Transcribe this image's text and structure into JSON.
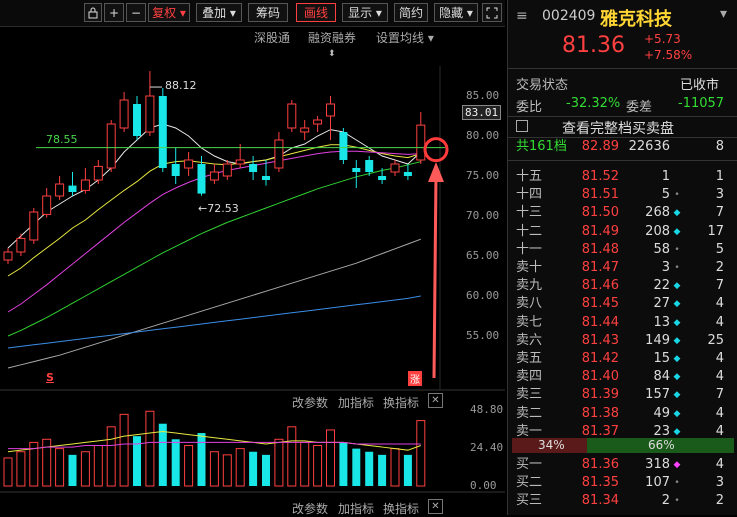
{
  "toolbar": {
    "buttons": [
      "+",
      "−",
      "复权",
      "叠加",
      "筹码",
      "画线",
      "显示",
      "简约",
      "隐藏"
    ],
    "icons": [
      "lock-icon",
      "expand-icon"
    ],
    "subnav": [
      "深股通",
      "融资融券",
      "设置均线"
    ]
  },
  "chart": {
    "price_ticks": [
      "85.00",
      "83.01",
      "80.00",
      "75.00",
      "70.00",
      "65.00",
      "60.00",
      "55.00"
    ],
    "high_label": "88.12",
    "low_label": "72.53",
    "ref_label": "78.55",
    "s_marker": "S",
    "zhang_badge": "涨",
    "indicator_bar1": [
      "改参数",
      "加指标",
      "换指标"
    ],
    "volume_ticks": [
      "48.80",
      "24.40",
      "0.00"
    ],
    "indicator_bar2": [
      "改参数",
      "加指标",
      "换指标"
    ],
    "candles": [
      {
        "o": 64.5,
        "c": 65.5,
        "h": 66.0,
        "l": 64.0
      },
      {
        "o": 65.5,
        "c": 67.2,
        "h": 67.8,
        "l": 65.0
      },
      {
        "o": 67.0,
        "c": 70.5,
        "h": 71.0,
        "l": 66.5
      },
      {
        "o": 70.2,
        "c": 72.5,
        "h": 73.5,
        "l": 69.8
      },
      {
        "o": 72.5,
        "c": 74.0,
        "h": 75.0,
        "l": 72.0
      },
      {
        "o": 73.8,
        "c": 73.0,
        "h": 75.5,
        "l": 72.5
      },
      {
        "o": 73.2,
        "c": 74.5,
        "h": 76.0,
        "l": 72.8
      },
      {
        "o": 74.5,
        "c": 76.2,
        "h": 77.0,
        "l": 74.0
      },
      {
        "o": 76.0,
        "c": 81.5,
        "h": 82.0,
        "l": 75.5
      },
      {
        "o": 81.0,
        "c": 84.5,
        "h": 85.5,
        "l": 80.5
      },
      {
        "o": 84.0,
        "c": 80.0,
        "h": 85.0,
        "l": 79.5
      },
      {
        "o": 80.5,
        "c": 85.0,
        "h": 88.12,
        "l": 80.0
      },
      {
        "o": 85.0,
        "c": 76.0,
        "h": 86.0,
        "l": 75.5
      },
      {
        "o": 76.5,
        "c": 75.0,
        "h": 78.5,
        "l": 74.0
      },
      {
        "o": 76.0,
        "c": 77.0,
        "h": 78.0,
        "l": 75.0
      },
      {
        "o": 76.5,
        "c": 72.8,
        "h": 77.5,
        "l": 72.53
      },
      {
        "o": 74.5,
        "c": 75.5,
        "h": 76.5,
        "l": 74.0
      },
      {
        "o": 75.0,
        "c": 76.5,
        "h": 77.0,
        "l": 74.5
      },
      {
        "o": 76.5,
        "c": 77.0,
        "h": 79.0,
        "l": 76.0
      },
      {
        "o": 76.5,
        "c": 75.5,
        "h": 77.5,
        "l": 74.5
      },
      {
        "o": 75.0,
        "c": 74.5,
        "h": 77.0,
        "l": 73.8
      },
      {
        "o": 76.0,
        "c": 79.5,
        "h": 80.5,
        "l": 75.5
      },
      {
        "o": 81.0,
        "c": 84.0,
        "h": 84.5,
        "l": 80.5
      },
      {
        "o": 80.5,
        "c": 81.0,
        "h": 82.0,
        "l": 79.5
      },
      {
        "o": 81.5,
        "c": 82.0,
        "h": 82.5,
        "l": 80.5
      },
      {
        "o": 82.5,
        "c": 84.0,
        "h": 85.0,
        "l": 79.5
      },
      {
        "o": 80.5,
        "c": 77.0,
        "h": 81.0,
        "l": 76.5
      },
      {
        "o": 76.0,
        "c": 75.5,
        "h": 77.0,
        "l": 73.5
      },
      {
        "o": 77.0,
        "c": 75.5,
        "h": 77.5,
        "l": 75.0
      },
      {
        "o": 75.0,
        "c": 74.5,
        "h": 76.0,
        "l": 74.0
      },
      {
        "o": 75.5,
        "c": 76.5,
        "h": 77.0,
        "l": 75.0
      },
      {
        "o": 75.5,
        "c": 75.0,
        "h": 76.5,
        "l": 74.5
      },
      {
        "o": 77.0,
        "c": 81.36,
        "h": 83.01,
        "l": 76.5
      }
    ],
    "ma": {
      "white": [
        66.0,
        67.5,
        69.0,
        70.5,
        71.5,
        72.5,
        73.3,
        74.5,
        76.0,
        78.0,
        79.5,
        81.0,
        81.5,
        81.0,
        80.0,
        78.5,
        77.5,
        76.8,
        76.5,
        76.8,
        77.0,
        77.5,
        78.5,
        79.0,
        80.0,
        80.8,
        80.5,
        79.5,
        78.5,
        77.5,
        77.0,
        76.5,
        78.0
      ],
      "yellow": [
        62.5,
        63.5,
        64.8,
        66.0,
        67.2,
        68.5,
        69.5,
        70.8,
        72.0,
        73.2,
        74.3,
        75.6,
        76.5,
        76.8,
        76.9,
        76.7,
        76.5,
        76.4,
        76.6,
        76.8,
        77.0,
        77.4,
        77.8,
        78.2,
        78.6,
        78.9,
        78.9,
        78.6,
        78.2,
        77.8,
        77.5,
        77.3,
        77.8
      ],
      "magenta": [
        58.0,
        59.0,
        60.2,
        61.4,
        62.7,
        64.0,
        65.3,
        66.6,
        67.9,
        69.2,
        70.4,
        71.6,
        72.7,
        73.5,
        74.2,
        74.8,
        75.3,
        75.7,
        76.0,
        76.3,
        76.6,
        76.9,
        77.2,
        77.5,
        77.8,
        78.0,
        78.1,
        78.1,
        78.0,
        77.9,
        77.8,
        77.7,
        77.8
      ],
      "green": [
        55.0,
        55.7,
        56.5,
        57.3,
        58.2,
        59.1,
        60.0,
        60.9,
        61.8,
        62.7,
        63.6,
        64.5,
        65.4,
        66.2,
        67.0,
        67.8,
        68.5,
        69.2,
        69.8,
        70.4,
        71.0,
        71.6,
        72.2,
        72.8,
        73.4,
        73.9,
        74.4,
        74.9,
        75.3,
        75.7,
        76.0,
        76.4,
        76.8
      ],
      "gray": [
        51.0,
        51.4,
        51.8,
        52.2,
        52.6,
        53.1,
        53.6,
        54.1,
        54.6,
        55.1,
        55.6,
        56.1,
        56.6,
        57.1,
        57.6,
        58.1,
        58.6,
        59.1,
        59.6,
        60.1,
        60.6,
        61.1,
        61.6,
        62.1,
        62.6,
        63.1,
        63.6,
        64.1,
        64.7,
        65.3,
        65.9,
        66.5,
        67.1
      ],
      "blue": [
        53.5,
        53.7,
        53.9,
        54.1,
        54.3,
        54.5,
        54.7,
        54.9,
        55.1,
        55.3,
        55.5,
        55.7,
        55.9,
        56.1,
        56.3,
        56.5,
        56.7,
        56.9,
        57.1,
        57.3,
        57.5,
        57.7,
        57.9,
        58.1,
        58.3,
        58.5,
        58.7,
        58.9,
        59.1,
        59.3,
        59.5,
        59.7,
        60.0
      ]
    },
    "volumes": [
      18,
      22,
      28,
      30,
      24,
      20,
      22,
      26,
      38,
      46,
      32,
      48,
      40,
      30,
      26,
      34,
      22,
      20,
      24,
      22,
      20,
      30,
      38,
      28,
      26,
      36,
      28,
      24,
      22,
      20,
      24,
      20,
      42
    ],
    "vol_ma_white": [
      22,
      23,
      24,
      25,
      26,
      27,
      28,
      29,
      30,
      32,
      33,
      34,
      35,
      34,
      33,
      32,
      31,
      30,
      29,
      28,
      27,
      28,
      29,
      29,
      28,
      28,
      28,
      27,
      26,
      25,
      24,
      23,
      26
    ],
    "vol_ma_magenta": [
      24,
      24,
      24,
      25,
      25,
      25,
      26,
      26,
      26,
      27,
      27,
      28,
      28,
      28,
      28,
      28,
      28,
      28,
      28,
      28,
      28,
      28,
      28,
      28,
      28,
      28,
      28,
      27,
      27,
      27,
      27,
      27,
      27
    ]
  },
  "quote": {
    "code": "002409",
    "name": "雅克科技",
    "price": "81.36",
    "change": "+5.73",
    "change_pct": "+7.58%",
    "status_label": "交易状态",
    "status_value": "已收市",
    "weibi_label": "委比",
    "weibi_value": "-32.32%",
    "weicha_label": "委差",
    "weicha_value": "-11057",
    "full_book_label": "查看完整档买卖盘",
    "summary": {
      "label": "共161档",
      "price": "82.89",
      "volume": "22636",
      "count": "8"
    },
    "asks": [
      {
        "name": "十五",
        "price": "81.52",
        "vol": "1",
        "dot": "",
        "cnt": "1"
      },
      {
        "name": "十四",
        "price": "81.51",
        "vol": "5",
        "dot": "•",
        "cnt": "3"
      },
      {
        "name": "十三",
        "price": "81.50",
        "vol": "268",
        "dot": "◆",
        "cnt": "7"
      },
      {
        "name": "十二",
        "price": "81.49",
        "vol": "208",
        "dot": "◆",
        "cnt": "17"
      },
      {
        "name": "十一",
        "price": "81.48",
        "vol": "58",
        "dot": "•",
        "cnt": "5"
      },
      {
        "name": "卖十",
        "price": "81.47",
        "vol": "3",
        "dot": "•",
        "cnt": "2"
      },
      {
        "name": "卖九",
        "price": "81.46",
        "vol": "22",
        "dot": "◆",
        "cnt": "7"
      },
      {
        "name": "卖八",
        "price": "81.45",
        "vol": "27",
        "dot": "◆",
        "cnt": "4"
      },
      {
        "name": "卖七",
        "price": "81.44",
        "vol": "13",
        "dot": "◆",
        "cnt": "4"
      },
      {
        "name": "卖六",
        "price": "81.43",
        "vol": "149",
        "dot": "◆",
        "cnt": "25"
      },
      {
        "name": "卖五",
        "price": "81.42",
        "vol": "15",
        "dot": "◆",
        "cnt": "4"
      },
      {
        "name": "卖四",
        "price": "81.40",
        "vol": "84",
        "dot": "◆",
        "cnt": "4"
      },
      {
        "name": "卖三",
        "price": "81.39",
        "vol": "157",
        "dot": "◆",
        "cnt": "7"
      },
      {
        "name": "卖二",
        "price": "81.38",
        "vol": "49",
        "dot": "◆",
        "cnt": "4"
      },
      {
        "name": "卖一",
        "price": "81.37",
        "vol": "23",
        "dot": "◆",
        "cnt": "4"
      }
    ],
    "ratio_sell": "34%",
    "ratio_buy": "66%",
    "bids": [
      {
        "name": "买一",
        "price": "81.36",
        "vol": "318",
        "dot": "◆",
        "cnt": "4"
      },
      {
        "name": "买二",
        "price": "81.35",
        "vol": "107",
        "dot": "•",
        "cnt": "3"
      },
      {
        "name": "买三",
        "price": "81.34",
        "vol": "2",
        "dot": "•",
        "cnt": "2"
      }
    ]
  }
}
